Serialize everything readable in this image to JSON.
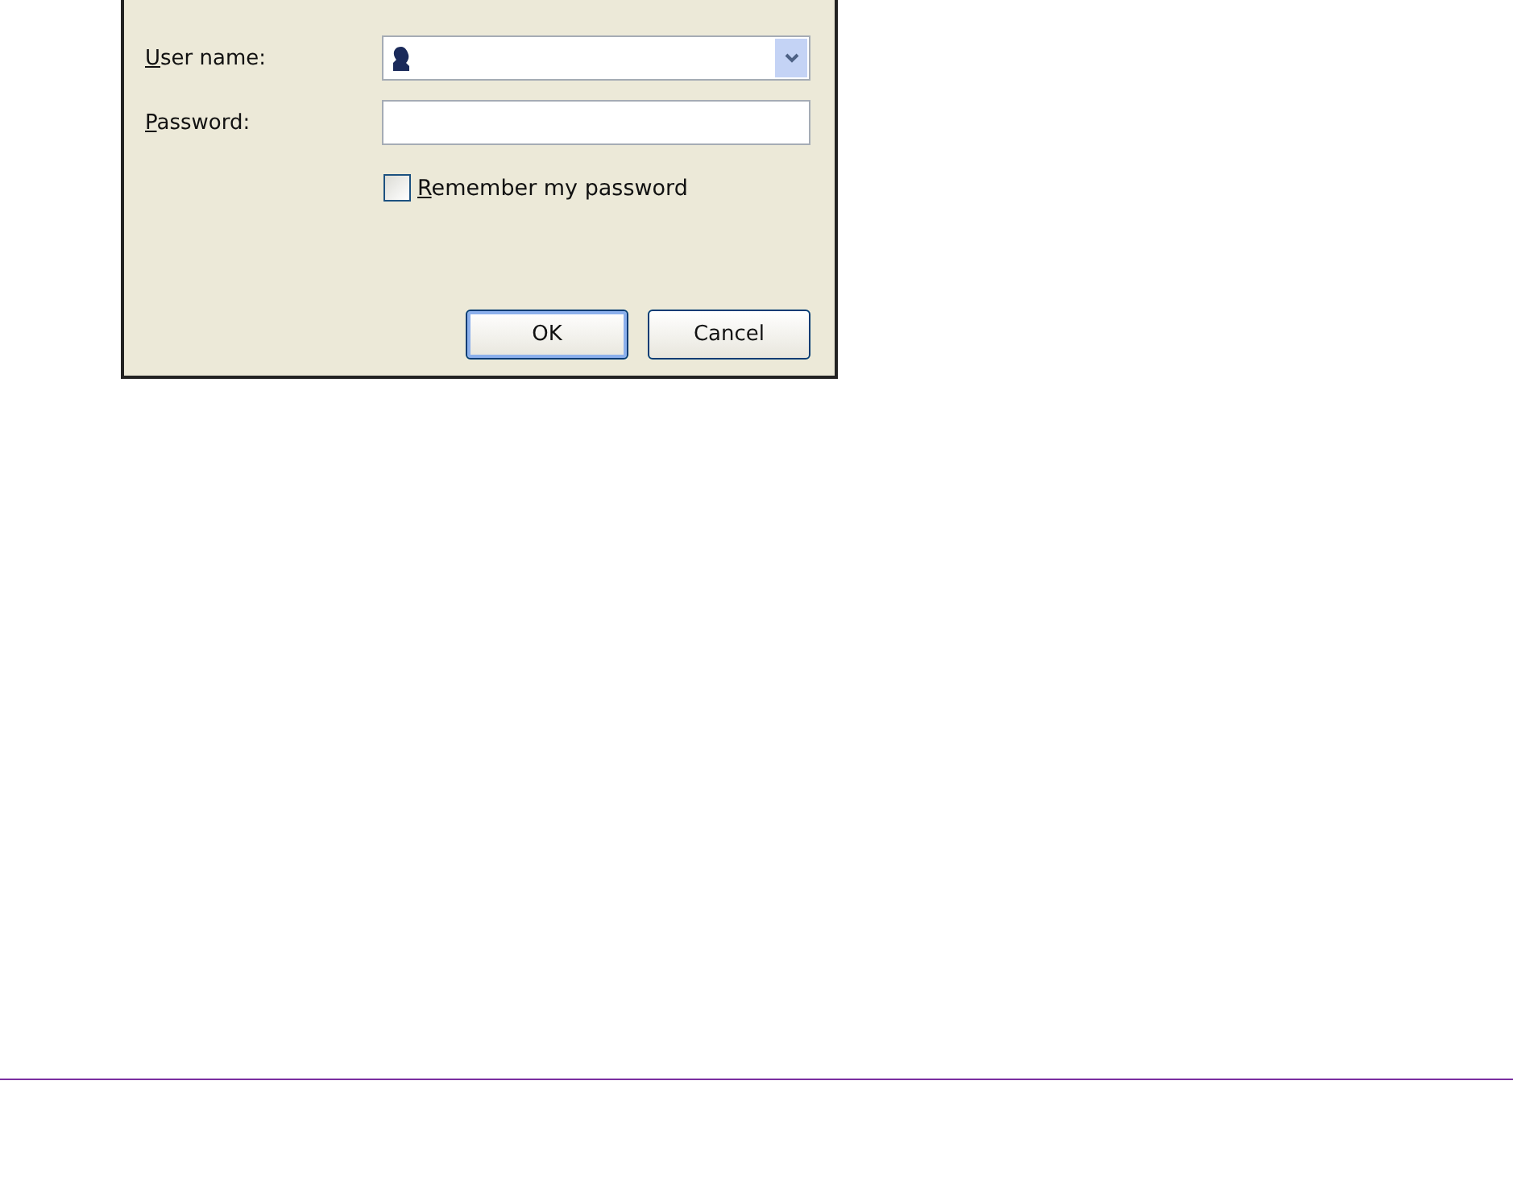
{
  "dialog": {
    "fields": [
      {
        "kind": "combo",
        "label": "User name:",
        "underline_first": true
      },
      {
        "kind": "password",
        "label": "Password:",
        "underline_first": true
      }
    ],
    "remember": {
      "label": "Remember my password",
      "checked": false,
      "underline_first": true
    },
    "buttons": [
      {
        "label": "OK",
        "default": true
      },
      {
        "label": "Cancel",
        "default": false
      }
    ]
  }
}
